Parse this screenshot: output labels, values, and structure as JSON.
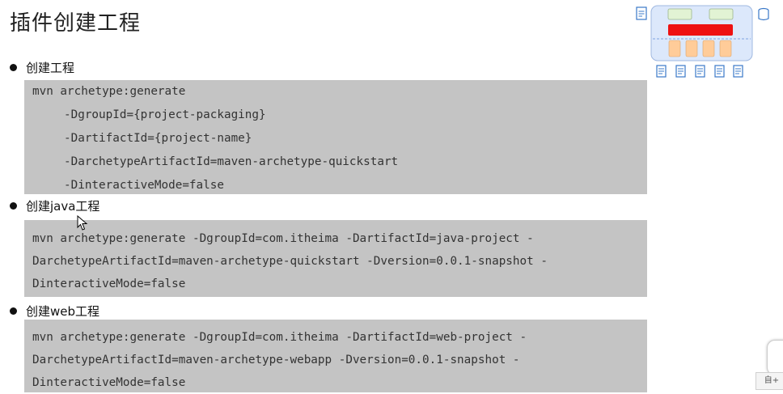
{
  "slide": {
    "title": "插件创建工程"
  },
  "sections": [
    {
      "label": "创建工程",
      "lines": [
        "mvn archetype:generate",
        "-DgroupId={project-packaging}",
        "-DartifactId={project-name}",
        "-DarchetypeArtifactId=maven-archetype-quickstart",
        "-DinteractiveMode=false"
      ]
    },
    {
      "label": "创建java工程",
      "lines": [
        "mvn archetype:generate -DgroupId=com.itheima -DartifactId=java-project -",
        "DarchetypeArtifactId=maven-archetype-quickstart -Dversion=0.0.1-snapshot -",
        "DinteractiveMode=false"
      ]
    },
    {
      "label": "创建web工程",
      "lines": [
        "mvn archetype:generate -DgroupId=com.itheima -DartifactId=web-project -",
        "DarchetypeArtifactId=maven-archetype-webapp -Dversion=0.0.1-snapshot -",
        "DinteractiveMode=false"
      ]
    }
  ],
  "overlay": {
    "corner_button_text": "自+"
  },
  "colors": {
    "code_background": "#c4c4c4",
    "diagram_bar": "#ee1111",
    "diagram_module": "#ffcc99",
    "diagram_box": "#dce8fb"
  },
  "icons": [
    "document-icon",
    "database-icon",
    "cursor-arrow-icon"
  ]
}
